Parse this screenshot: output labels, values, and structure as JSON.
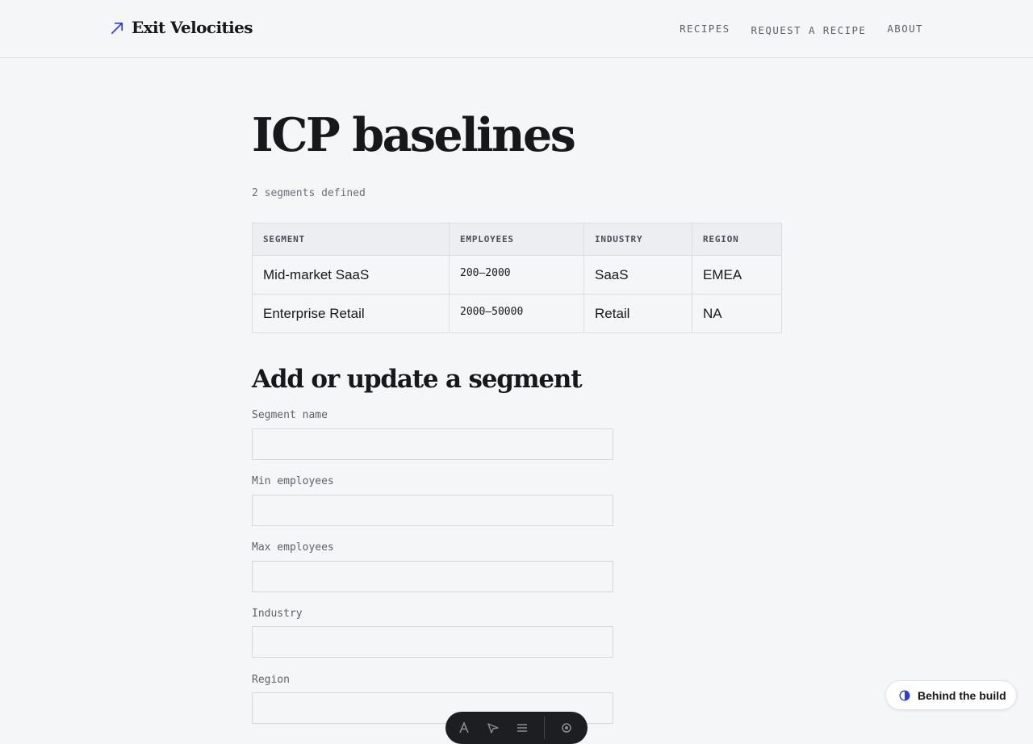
{
  "header": {
    "brand": "Exit Velocities",
    "nav": {
      "recipes": "RECIPES",
      "request": "REQUEST A RECIPE",
      "about": "ABOUT"
    }
  },
  "page": {
    "title": "ICP baselines",
    "subtitle": "2 segments defined"
  },
  "table": {
    "headers": [
      "SEGMENT",
      "EMPLOYEES",
      "INDUSTRY",
      "REGION"
    ],
    "rows": [
      [
        "Mid-market SaaS",
        "200–2000",
        "SaaS",
        "EMEA"
      ],
      [
        "Enterprise Retail",
        "2000–50000",
        "Retail",
        "NA"
      ]
    ]
  },
  "form": {
    "title": "Add or update a segment",
    "fields": [
      {
        "label": "Segment name",
        "value": ""
      },
      {
        "label": "Min employees",
        "value": ""
      },
      {
        "label": "Max employees",
        "value": ""
      },
      {
        "label": "Industry",
        "value": ""
      },
      {
        "label": "Region",
        "value": ""
      }
    ]
  },
  "floating": {
    "behind_label": "Behind the build"
  },
  "colors": {
    "accent": "#2b3ed6",
    "background": "#f5f6f8",
    "dock": "#1d1e22"
  },
  "icons": {
    "brand": "arrow-up-right-icon",
    "behind": "half-circle-icon",
    "dock": [
      "font-icon",
      "cursor-icon",
      "list-icon",
      "gear-icon"
    ]
  }
}
